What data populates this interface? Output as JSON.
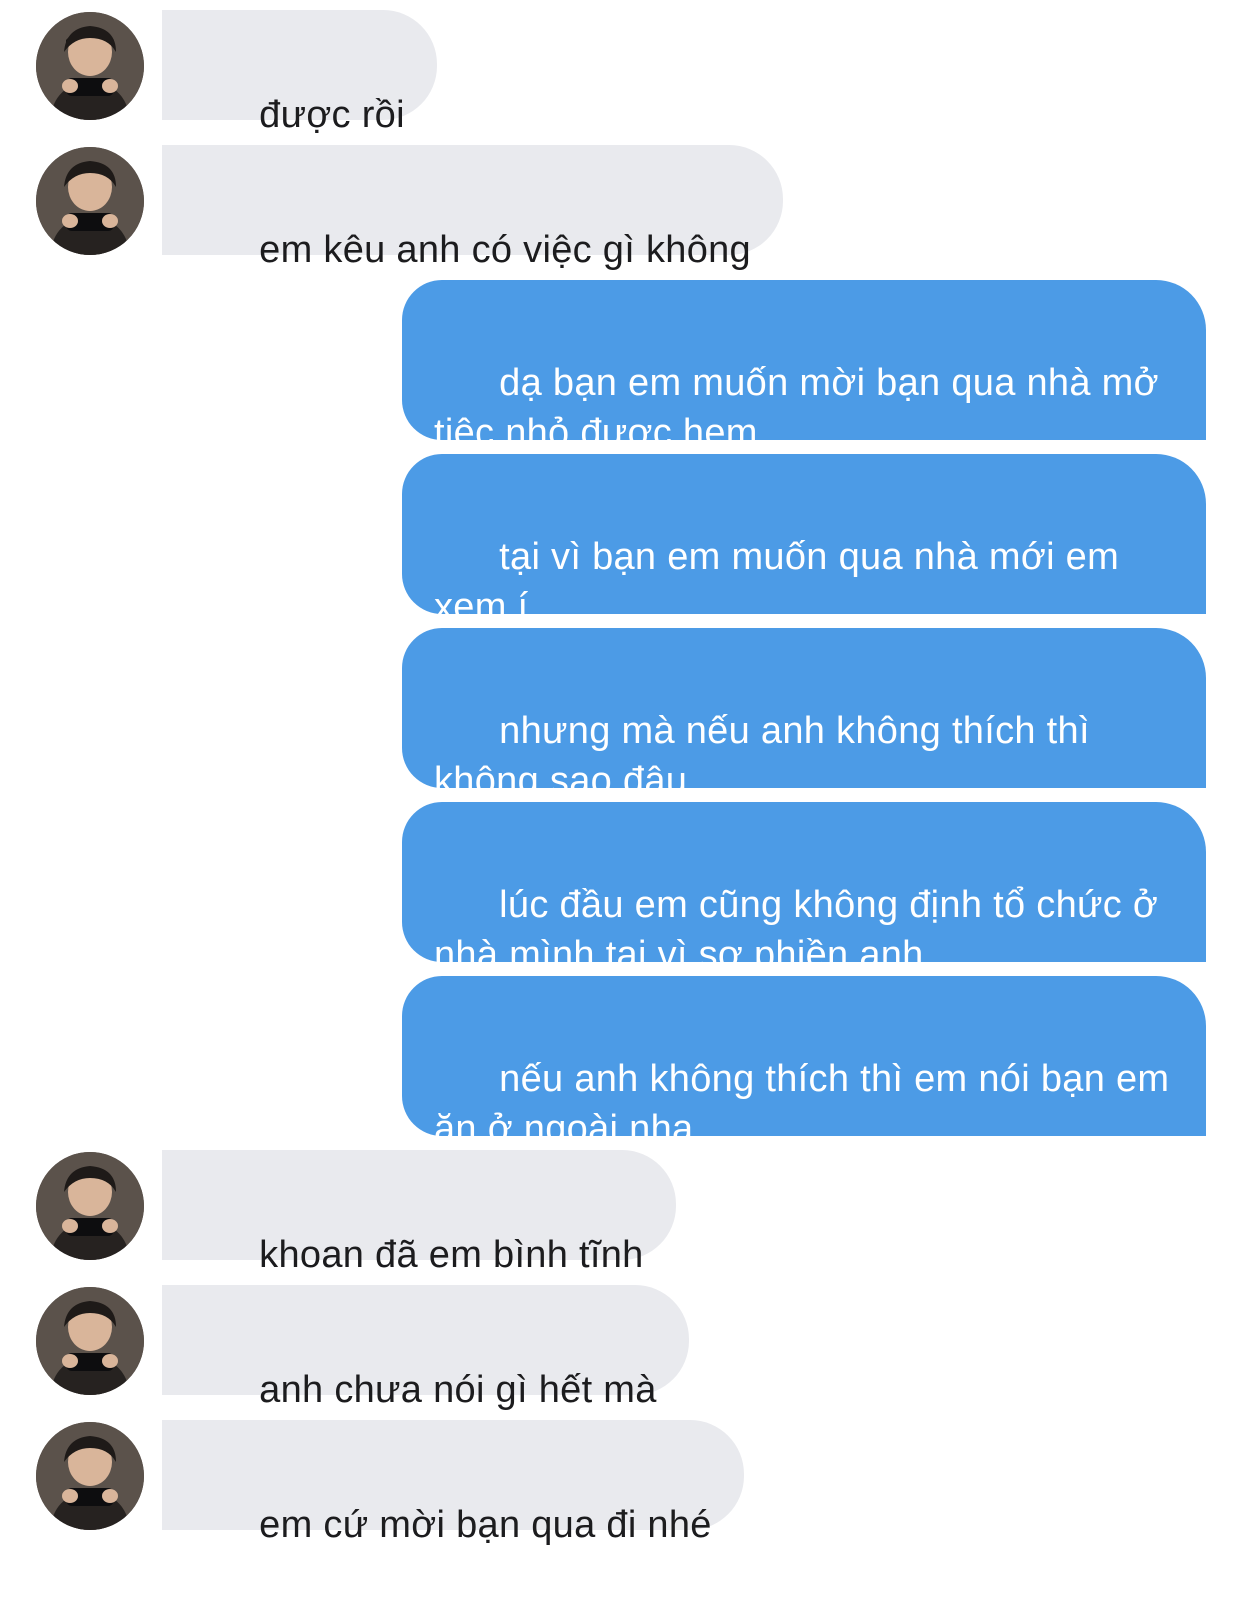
{
  "colors": {
    "incoming_bubble": "#e9eaee",
    "outgoing_bubble": "#4c9be6",
    "incoming_text": "#1c1c1e",
    "outgoing_text": "#ffffff"
  },
  "messages": [
    {
      "side": "in",
      "text": "được rồi"
    },
    {
      "side": "in",
      "text": "em kêu anh có việc gì không"
    },
    {
      "side": "out",
      "text": "dạ bạn em muốn mời bạn qua nhà mở tiệc nhỏ được hem.."
    },
    {
      "side": "out",
      "text": "tại vì bạn em muốn qua nhà mới em xem í"
    },
    {
      "side": "out",
      "text": "nhưng mà nếu anh không thích thì không sao đâu"
    },
    {
      "side": "out",
      "text": "lúc đầu em cũng không định tổ chức ở nhà mình tại vì sợ phiền anh"
    },
    {
      "side": "out",
      "text": "nếu anh không thích thì em nói bạn em ăn ở ngoài nha"
    },
    {
      "side": "in",
      "text": "khoan đã em bình tĩnh"
    },
    {
      "side": "in",
      "text": "anh chưa nói gì hết mà"
    },
    {
      "side": "in",
      "text": "em cứ mời bạn qua đi nhé"
    }
  ]
}
